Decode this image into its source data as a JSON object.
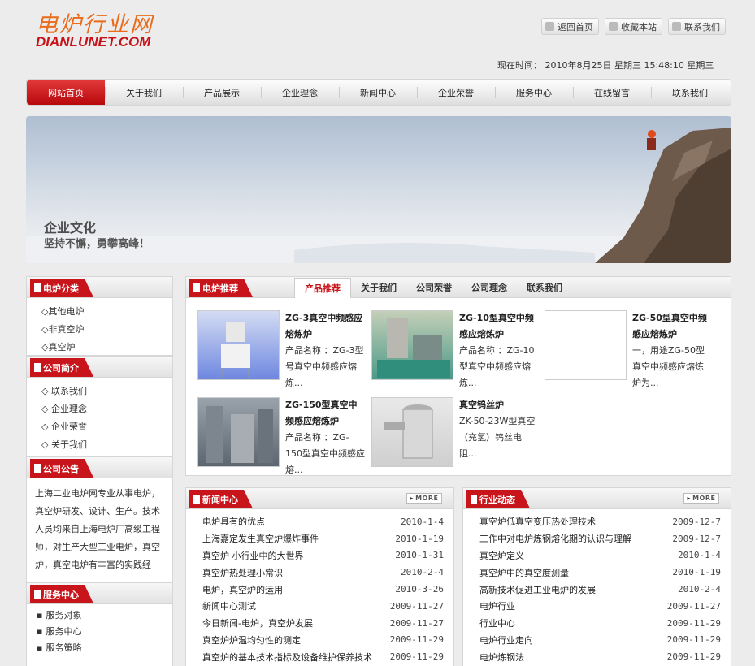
{
  "header": {
    "logo_cn": "电炉行业网",
    "logo_en": "DIANLUNET.COM",
    "links": [
      "返回首页",
      "收藏本站",
      "联系我们"
    ],
    "datetime": "现在时间： 2010年8月25日 星期三 15:48:10 星期三"
  },
  "nav": [
    "网站首页",
    "关于我们",
    "产品展示",
    "企业理念",
    "新闻中心",
    "企业荣誉",
    "服务中心",
    "在线留言",
    "联系我们"
  ],
  "banner": {
    "title": "企业文化",
    "subtitle": "坚持不懈，勇攀高峰！"
  },
  "sidebar": {
    "categories": {
      "title": "电炉分类",
      "items": [
        "◇其他电炉",
        "◇非真空炉",
        "◇真空炉"
      ]
    },
    "about": {
      "title": "公司简介",
      "items": [
        "◇ 联系我们",
        "◇ 企业理念",
        "◇ 企业荣誉",
        "◇ 关于我们"
      ]
    },
    "notice": {
      "title": "公司公告",
      "text": "上海二业电炉网专业从事电炉，真空炉研发、设计、生产。技术人员均来自上海电炉厂高级工程师，对生产大型工业电炉，真空炉，真空电炉有丰富的实践经验，在大型真空"
    },
    "service": {
      "title": "服务中心",
      "items": [
        "服务对象",
        "服务中心",
        "服务策略"
      ]
    }
  },
  "products": {
    "title": "电炉推荐",
    "tabs": [
      "产品推荐",
      "关于我们",
      "公司荣誉",
      "公司理念",
      "联系我们"
    ],
    "items": [
      {
        "name": "ZG-3真空中频感应熔炼炉",
        "desc": "产品名称 ：ZG-3型号真空中频感应熔炼..."
      },
      {
        "name": "ZG-10型真空中频感应熔炼炉",
        "desc": "产品名称 ：ZG-10型真空中频感应熔炼..."
      },
      {
        "name": "ZG-50型真空中频感应熔炼炉",
        "desc": "一，用途ZG-50型真空中频感应熔炼炉为..."
      },
      {
        "name": "ZG-150型真空中频感应熔炼炉",
        "desc": "产品名称 ：ZG-150型真空中频感应熔..."
      },
      {
        "name": "真空钨丝炉",
        "desc": "ZK-50-23W型真空（充氢）钨丝电阻..."
      }
    ]
  },
  "news": {
    "title": "新闻中心",
    "more": "MORE",
    "rows": [
      {
        "title": "电炉具有的优点",
        "date": "2010-1-4"
      },
      {
        "title": "上海嘉定发生真空炉爆炸事件",
        "date": "2010-1-19"
      },
      {
        "title": "真空炉 小行业中的大世界",
        "date": "2010-1-31"
      },
      {
        "title": "真空炉热处理小常识",
        "date": "2010-2-4"
      },
      {
        "title": "电炉，真空炉的运用",
        "date": "2010-3-26"
      },
      {
        "title": "新闻中心测试",
        "date": "2009-11-27"
      },
      {
        "title": "今日新闻-电炉，真空炉发展",
        "date": "2009-11-27"
      },
      {
        "title": "真空炉炉温均匀性的测定",
        "date": "2009-11-29"
      },
      {
        "title": "真空炉的基本技术指标及设备维护保养技术",
        "date": "2009-11-29"
      }
    ]
  },
  "industry": {
    "title": "行业动态",
    "more": "MORE",
    "rows": [
      {
        "title": "真空炉低真空变压热处理技术",
        "date": "2009-12-7"
      },
      {
        "title": "工作中对电炉炼钢熔化期的认识与理解",
        "date": "2009-12-7"
      },
      {
        "title": "真空炉定义",
        "date": "2010-1-4"
      },
      {
        "title": "真空炉中的真空度测量",
        "date": "2010-1-19"
      },
      {
        "title": "高新技术促进工业电炉的发展",
        "date": "2010-2-4"
      },
      {
        "title": "电炉行业",
        "date": "2009-11-27"
      },
      {
        "title": "行业中心",
        "date": "2009-11-29"
      },
      {
        "title": "电炉行业走向",
        "date": "2009-11-29"
      },
      {
        "title": "电炉炼钢法",
        "date": "2009-11-29"
      }
    ]
  }
}
